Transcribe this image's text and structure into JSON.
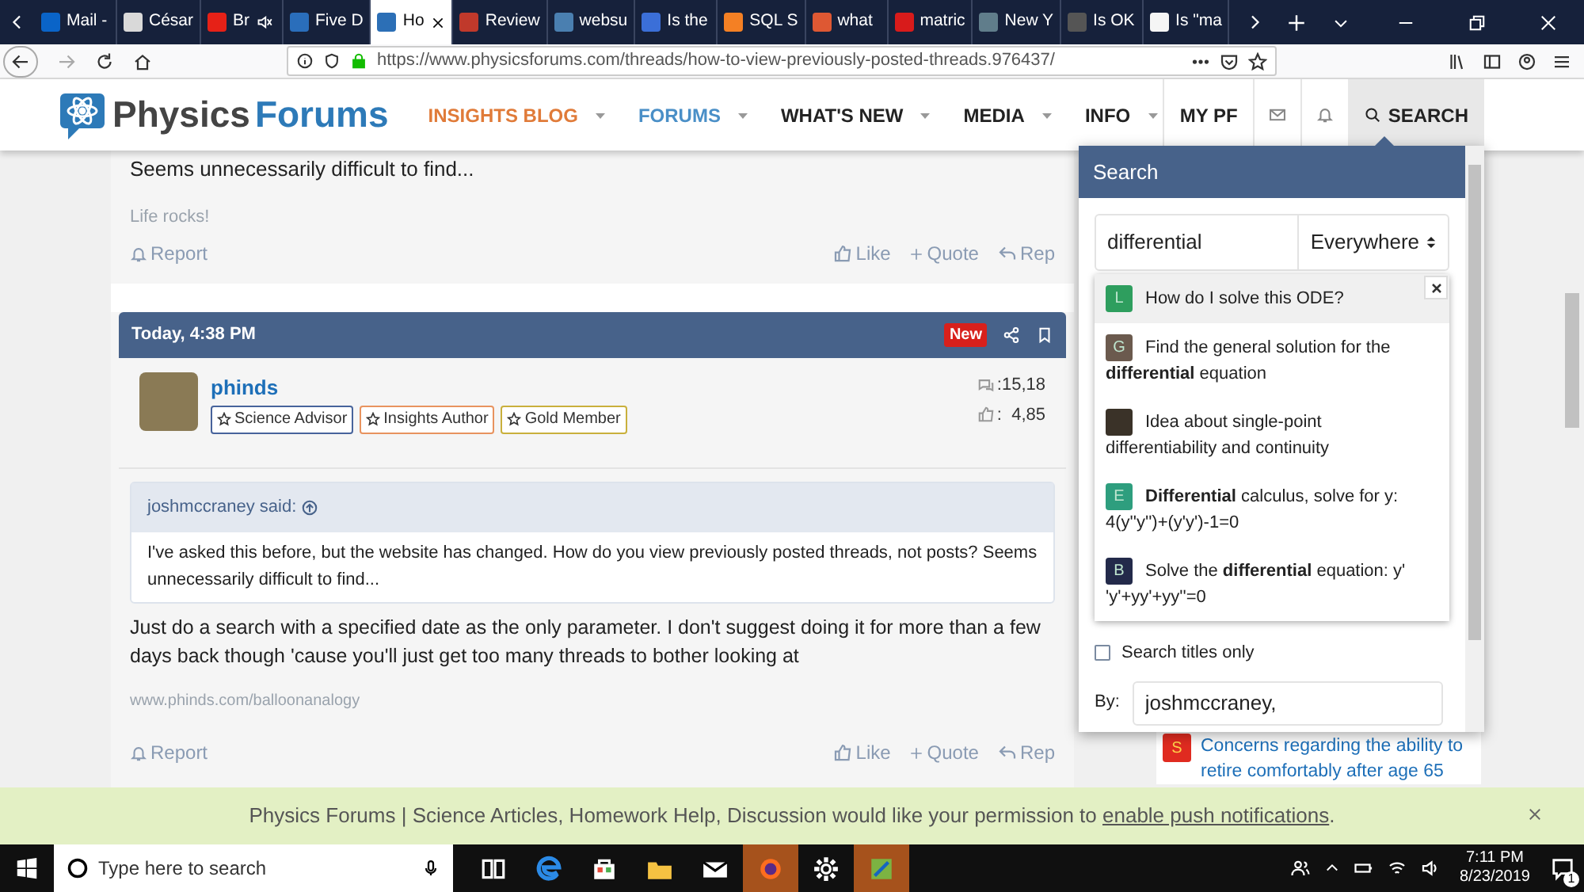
{
  "browser": {
    "tabs": [
      {
        "label": "Mail -",
        "color": "#0a64c8",
        "muted": false,
        "selected": false
      },
      {
        "label": "César",
        "color": "#d9d9d9",
        "muted": false,
        "selected": false
      },
      {
        "label": "Br",
        "color": "#e62117",
        "muted": true,
        "selected": false
      },
      {
        "label": "Five D",
        "color": "#2a6ebb",
        "muted": false,
        "selected": false
      },
      {
        "label": "Ho",
        "color": "#2c6fb6",
        "muted": false,
        "selected": true
      },
      {
        "label": "Review",
        "color": "#c0392b",
        "muted": false,
        "selected": false
      },
      {
        "label": "websu",
        "color": "#4a7fb0",
        "muted": false,
        "selected": false
      },
      {
        "label": "Is the",
        "color": "#3b6fd8",
        "muted": false,
        "selected": false
      },
      {
        "label": "SQL S",
        "color": "#f48024",
        "muted": false,
        "selected": false
      },
      {
        "label": "what",
        "color": "#de5833",
        "muted": false,
        "selected": false
      },
      {
        "label": "matric",
        "color": "#d81b1b",
        "muted": false,
        "selected": false
      },
      {
        "label": "New Y",
        "color": "#607d8b",
        "muted": false,
        "selected": false
      },
      {
        "label": "Is OK",
        "color": "#555555",
        "muted": false,
        "selected": false
      },
      {
        "label": "Is \"ma",
        "color": "#f5f5f5",
        "muted": false,
        "selected": false
      }
    ],
    "url": "https://www.physicsforums.com/threads/how-to-view-previously-posted-threads.976437/"
  },
  "site_header": {
    "logo_text": [
      "Physics",
      "Forums"
    ],
    "nav": [
      {
        "label": "INSIGHTS BLOG",
        "color": "#e07b39"
      },
      {
        "label": "FORUMS",
        "color": "#4a8fc7"
      },
      {
        "label": "WHAT'S NEW",
        "color": "#222222"
      },
      {
        "label": "MEDIA",
        "color": "#222222"
      },
      {
        "label": "INFO",
        "color": "#222222"
      }
    ],
    "my_pf": "MY PF",
    "search_button": {
      "label": "SEARCH",
      "selected": true
    }
  },
  "previous_post": {
    "text": "Seems unnecessarily difficult to find...",
    "signature": "Life rocks!",
    "actions": {
      "report": "Report",
      "like": "Like",
      "quote": "Quote",
      "reply": "Rep"
    }
  },
  "post": {
    "date": "Today, 4:38 PM",
    "badge": "New",
    "author": "phinds",
    "user_badges": [
      {
        "label": "Science Advisor",
        "color": "#47639b"
      },
      {
        "label": "Insights Author",
        "color": "#e8935f"
      },
      {
        "label": "Gold Member",
        "color": "#c9b03c"
      }
    ],
    "stats": [
      ":15,18",
      ":  4,85"
    ],
    "quote": {
      "author": "joshmccraney said:",
      "text": "I've asked this before, but the website has changed. How do you view previously posted threads, not posts? Seems unnecessarily difficult to find..."
    },
    "body": "Just do a search with a specified date as the only parameter. I don't suggest doing it for more than a few days back though 'cause you'll just get too many threads to bother looking at",
    "signature": "www.phinds.com/balloonanalogy",
    "actions": {
      "report": "Report",
      "like": "Like",
      "quote": "Quote",
      "reply": "Rep"
    }
  },
  "sidebar_item": {
    "avatar": "S",
    "color": "#e02b20",
    "text": "Concerns regarding the ability to retire comfortably after age 65"
  },
  "search_panel": {
    "title": "Search",
    "query": "differential",
    "scope": "Everywhere",
    "results": [
      {
        "kind": "letter",
        "avatar": "L",
        "color": "#2e9e5e",
        "title": "How do I solve this ODE?",
        "selected": true
      },
      {
        "kind": "letter",
        "avatar": "G",
        "color": "#6b5a4e",
        "title": "Find the general solution for the **differential** equation",
        "selected": false
      },
      {
        "kind": "photo",
        "title": "Idea about single-point differentiability and continuity",
        "selected": false
      },
      {
        "kind": "letter",
        "avatar": "E",
        "color": "#2e9e7e",
        "title": "**Differential** calculus, solve for y: 4(y''y'')+(y'y')-1=0",
        "selected": false
      },
      {
        "kind": "letter",
        "avatar": "B",
        "color": "#232a4a",
        "title": "Solve the **differential** equation: y' 'y'+yy'+yy''=0",
        "selected": false
      }
    ],
    "titles_only": {
      "label": "Search titles only",
      "checked": false
    },
    "by": {
      "label": "By:",
      "value": "joshmccraney,"
    }
  },
  "notification": {
    "text": "Physics Forums | Science Articles, Homework Help, Discussion would like your permission to",
    "link": "enable push notifications",
    "end": "."
  },
  "taskbar": {
    "search_placeholder": "Type here to search",
    "apps": [
      {
        "kind": "taskview",
        "active": false
      },
      {
        "kind": "edge",
        "active": false
      },
      {
        "kind": "store",
        "active": false
      },
      {
        "kind": "explorer",
        "active": false
      },
      {
        "kind": "mail",
        "active": false
      },
      {
        "kind": "firefox",
        "active": true
      },
      {
        "kind": "settings",
        "active": false
      },
      {
        "kind": "app",
        "active": true
      }
    ],
    "time": "7:11 PM",
    "date": "8/23/2019",
    "notifications": "1"
  }
}
